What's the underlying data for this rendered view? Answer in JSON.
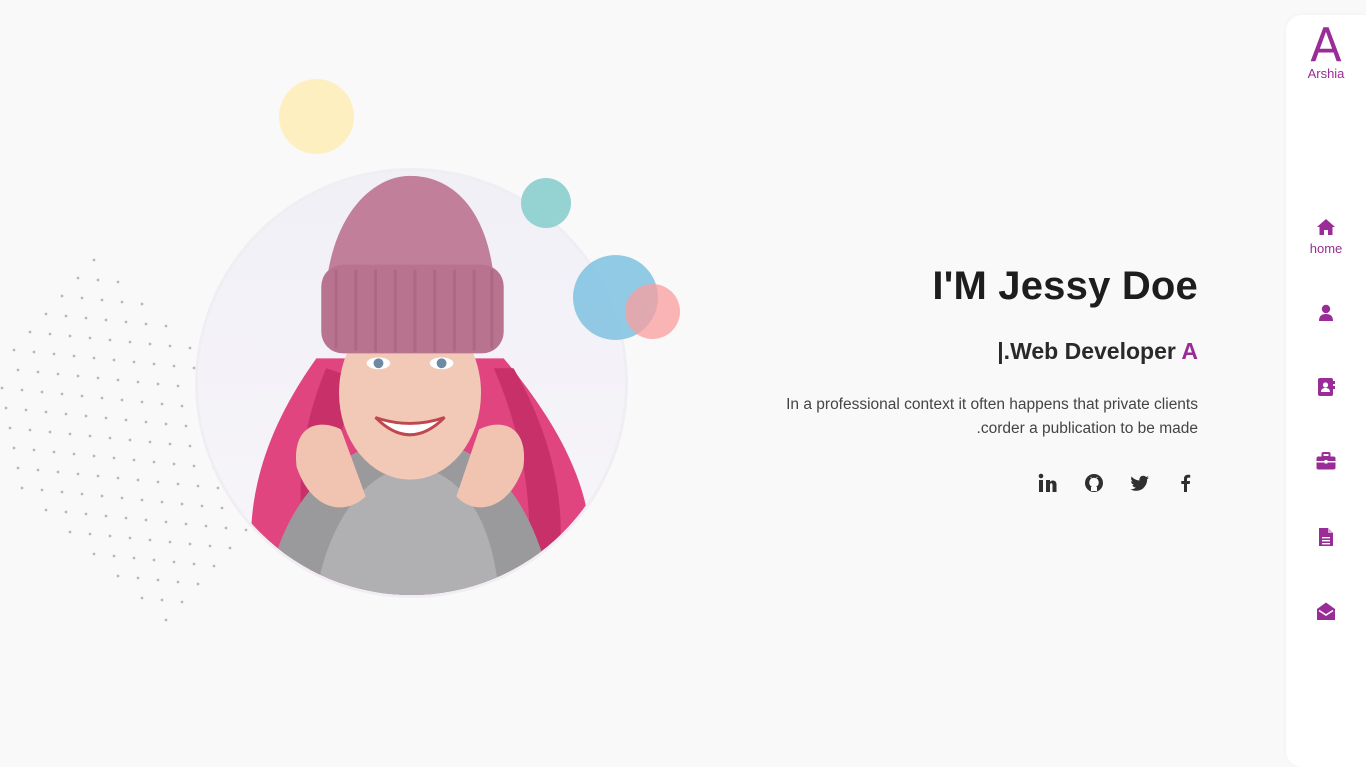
{
  "hero": {
    "title": "I'M Jessy Doe",
    "subtitle_prefix": "|.Web Developer",
    "subtitle_accent": "A",
    "description_line1": "In a professional context it often happens that private clients",
    "description_line2": ".corder a publication to be made"
  },
  "socials": [
    {
      "icon": "linkedin-icon"
    },
    {
      "icon": "github-icon"
    },
    {
      "icon": "twitter-icon"
    },
    {
      "icon": "facebook-icon"
    }
  ],
  "nav": {
    "logo_letter": "A",
    "logo_name": "Arshia",
    "items": [
      {
        "icon": "home-icon",
        "label": "home",
        "active": true
      },
      {
        "icon": "user-icon",
        "label": ""
      },
      {
        "icon": "contact-book-icon",
        "label": ""
      },
      {
        "icon": "briefcase-icon",
        "label": ""
      },
      {
        "icon": "document-icon",
        "label": ""
      },
      {
        "icon": "envelope-open-icon",
        "label": ""
      }
    ]
  },
  "colors": {
    "accent": "#9a2c97",
    "background": "#f9f9f9",
    "text": "#1d1d1d"
  }
}
